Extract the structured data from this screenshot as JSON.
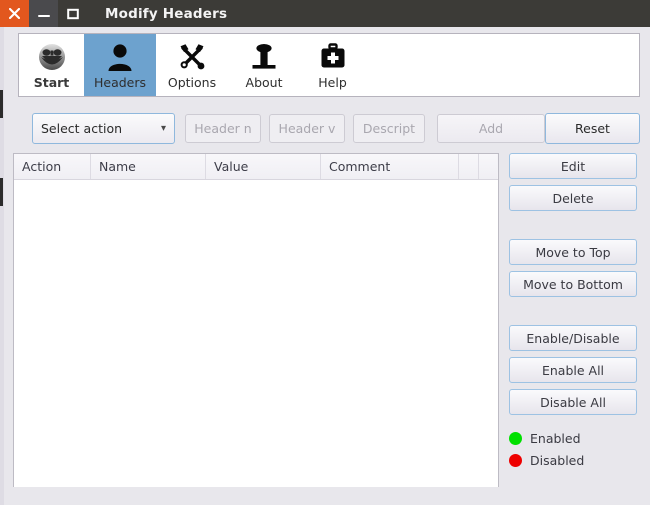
{
  "window": {
    "title": "Modify Headers",
    "controls": {
      "close": "close-icon",
      "minimize": "minimize-icon",
      "maximize": "maximize-icon"
    },
    "colors": {
      "titlebar_bg": "#3c3b37",
      "close_bg": "#e2571e",
      "active_tab_bg": "#6da2ce",
      "enabled_dot": "#00e000",
      "disabled_dot": "#ee0000",
      "window_bg": "#e8e7ec"
    }
  },
  "toolbar": {
    "items": [
      {
        "label": "Start",
        "icon": "smiley-mask-icon",
        "active": false
      },
      {
        "label": "Headers",
        "icon": "person-icon",
        "active": true
      },
      {
        "label": "Options",
        "icon": "tools-icon",
        "active": false
      },
      {
        "label": "About",
        "icon": "info-icon",
        "active": false
      },
      {
        "label": "Help",
        "icon": "first-aid-kit-icon",
        "active": false
      }
    ]
  },
  "action_row": {
    "select_action": {
      "value": "Select action",
      "arrow_icon": "chevron-down-icon"
    },
    "header_name": {
      "placeholder": "Header n"
    },
    "header_value": {
      "placeholder": "Header v"
    },
    "description": {
      "placeholder": "Descript"
    },
    "add_label": "Add",
    "reset_label": "Reset"
  },
  "table": {
    "columns": [
      "Action",
      "Name",
      "Value",
      "Comment",
      "",
      ""
    ],
    "rows": []
  },
  "side_buttons": {
    "edit": "Edit",
    "delete": "Delete",
    "move_top": "Move to Top",
    "move_bottom": "Move to Bottom",
    "enable_disable": "Enable/Disable",
    "enable_all": "Enable All",
    "disable_all": "Disable All"
  },
  "legend": {
    "enabled": "Enabled",
    "disabled": "Disabled"
  }
}
